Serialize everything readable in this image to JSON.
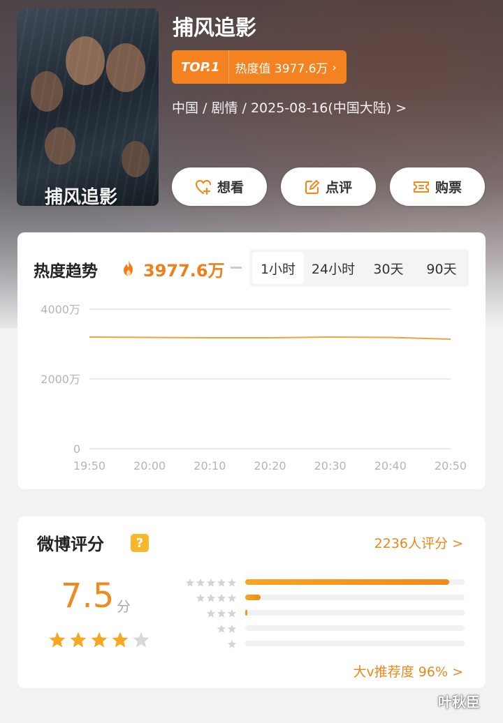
{
  "movie": {
    "title": "捕风追影",
    "rank_badge": "TOP.1",
    "heat_label": "热度值 3977.6万",
    "meta": "中国 / 剧情 / 2025-08-16(中国大陆) >"
  },
  "actions": {
    "want": "想看",
    "review": "点评",
    "buy": "购票"
  },
  "trend": {
    "title": "热度趋势",
    "value": "3977.6万",
    "tabs": [
      "1小时",
      "24小时",
      "30天",
      "90天"
    ],
    "active_tab": "1小时"
  },
  "chart_data": {
    "type": "line",
    "title": "",
    "xlabel": "",
    "ylabel": "",
    "x": [
      "19:50",
      "20:00",
      "20:10",
      "20:20",
      "20:30",
      "20:40",
      "20:50"
    ],
    "y_tick_labels": [
      "4000万",
      "2000万",
      "0"
    ],
    "y_ticks": [
      4000,
      2000,
      0
    ],
    "ylim": [
      0,
      4000
    ],
    "series": [
      {
        "values": [
          3200,
          3190,
          3180,
          3180,
          3200,
          3190,
          3140
        ]
      }
    ],
    "grid": true,
    "color": "#f0a23a"
  },
  "rating": {
    "title": "微博评分",
    "help_icon": "?",
    "count": "2236人评分 >",
    "score": "7.5",
    "score_unit": "分",
    "stars_filled": 4,
    "stars_total": 5,
    "distribution": [
      {
        "stars": 5,
        "fraction": 0.93
      },
      {
        "stars": 4,
        "fraction": 0.07
      },
      {
        "stars": 3,
        "fraction": 0.01
      },
      {
        "stars": 2,
        "fraction": 0.0
      },
      {
        "stars": 1,
        "fraction": 0.0
      }
    ],
    "recommend": "大v推荐度 96% >"
  },
  "watermark": "叶秋臣",
  "colors": {
    "accent": "#f58220",
    "accent_text": "#e8891a",
    "star": "#f7a823",
    "star_empty": "#d9d9d9"
  }
}
